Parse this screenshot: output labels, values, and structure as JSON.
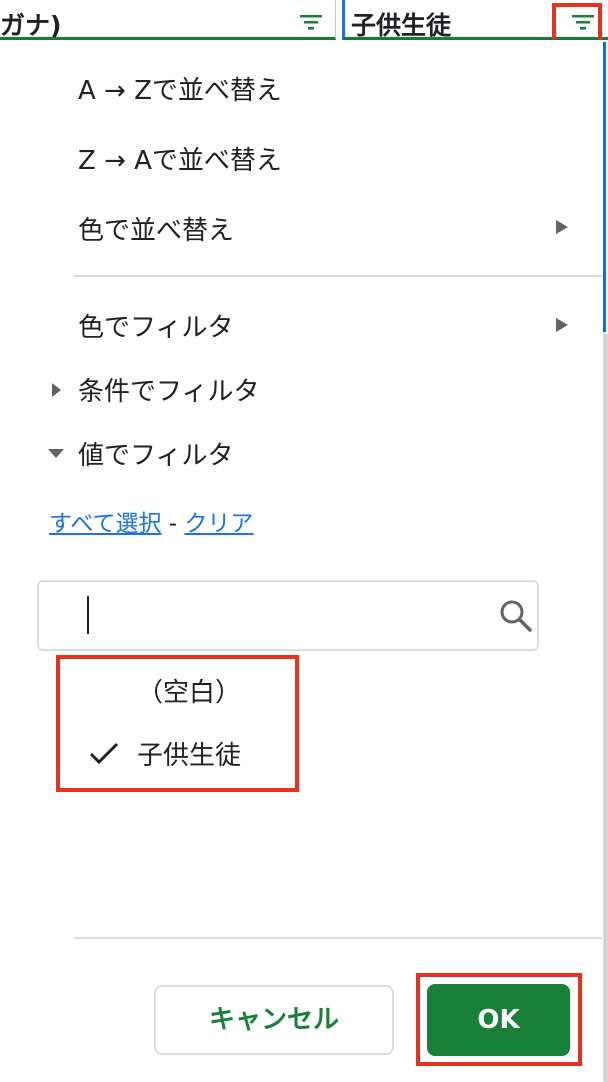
{
  "header": {
    "left_column_title": "ガナ)",
    "right_column_title": "子供生徒"
  },
  "menu": {
    "sort_az": "A → Zで並べ替え",
    "sort_za": "Z → Aで並べ替え",
    "sort_by_color": "色で並べ替え",
    "filter_by_color": "色でフィルタ",
    "filter_by_condition": "条件でフィルタ",
    "filter_by_values": "値でフィルタ"
  },
  "values_filter": {
    "select_all_label": "すべて選択",
    "separator": "-",
    "clear_label": "クリア",
    "search_value": "",
    "items": [
      {
        "label": "（空白）",
        "checked": false
      },
      {
        "label": "子供生徒",
        "checked": true
      }
    ]
  },
  "buttons": {
    "cancel_label": "キャンセル",
    "ok_label": "OK"
  },
  "colors": {
    "accent_green": "#188038",
    "link_blue": "#1a73e8",
    "highlight_red": "#e8301c"
  },
  "icons": {
    "filter": "filter-icon",
    "submenu": "triangle-right-icon",
    "collapsed": "triangle-right-icon",
    "expanded": "triangle-down-icon",
    "search": "search-icon",
    "check": "check-icon"
  }
}
